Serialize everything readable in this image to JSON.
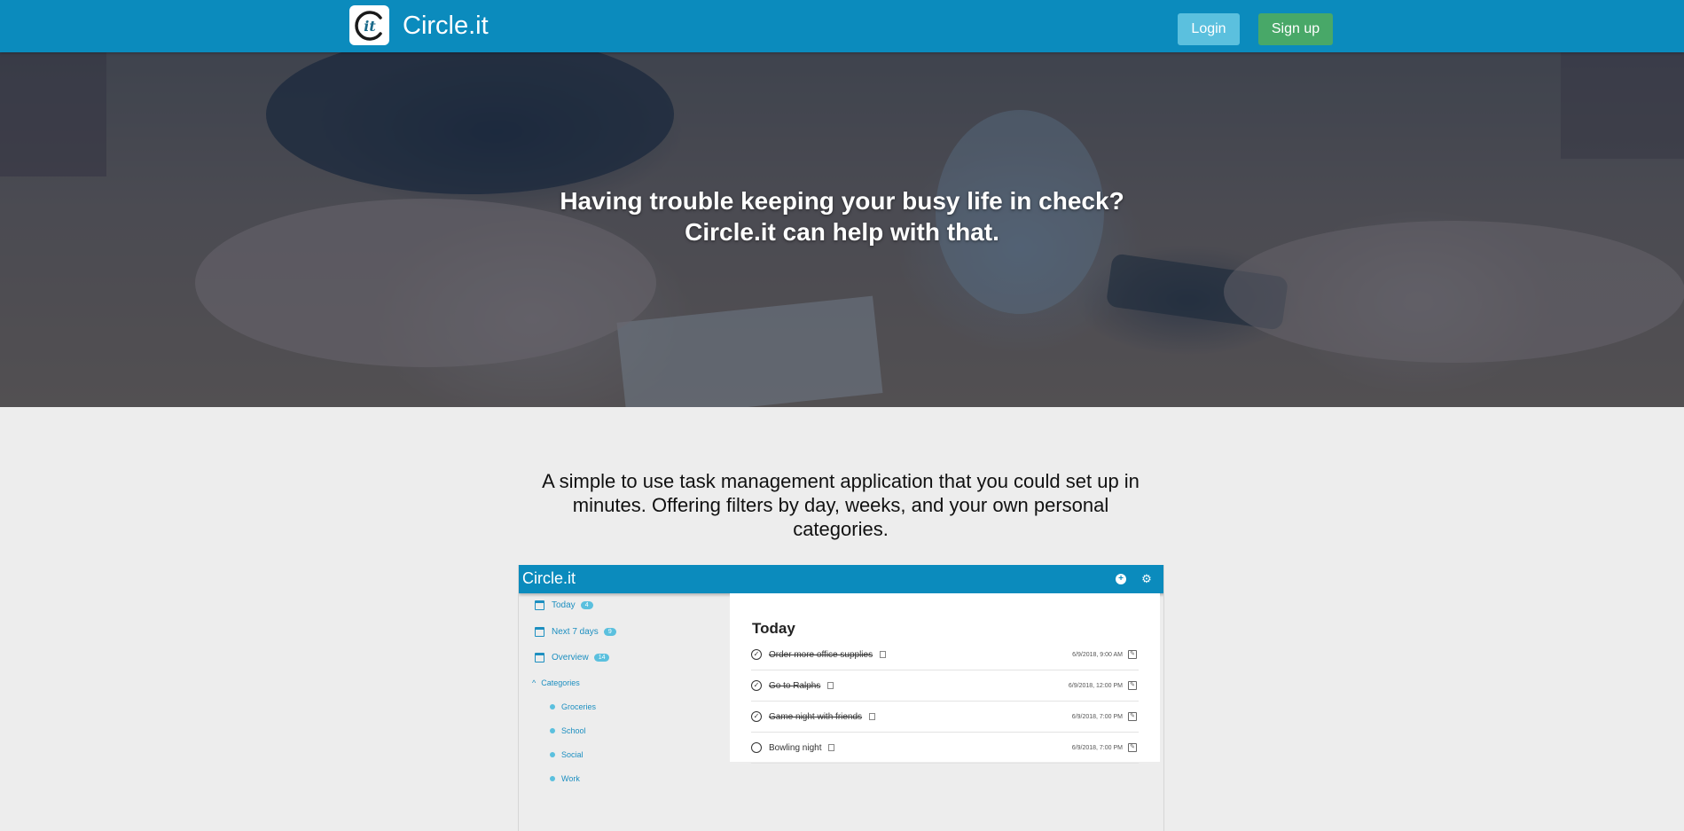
{
  "nav": {
    "brand": "Circle.it",
    "logo_text": "it",
    "login_label": "Login",
    "signup_label": "Sign up"
  },
  "hero": {
    "line1": "Having trouble keeping your busy life in check?",
    "line2": "Circle.it can help with that."
  },
  "description": "A simple to use task management application that you could set up in minutes. Offering filters by day, weeks, and your own personal categories.",
  "preview": {
    "title": "Circle.it",
    "add_icon": "plus-circle-icon",
    "settings_icon": "gear-icon",
    "sidebar": {
      "today_label": "Today",
      "today_count": "4",
      "next7_label": "Next 7 days",
      "next7_count": "9",
      "overview_label": "Overview",
      "overview_count": "14",
      "categories_label": "Categories",
      "categories": [
        "Groceries",
        "School",
        "Social",
        "Work"
      ]
    },
    "panel_title": "Today",
    "tasks": [
      {
        "name": "Order more office supplies",
        "time": "6/9/2018, 9:00 AM",
        "done": true
      },
      {
        "name": "Go to Ralphs",
        "time": "6/9/2018, 12:00 PM",
        "done": true
      },
      {
        "name": "Game night with friends",
        "time": "6/9/2018, 7:00 PM",
        "done": true
      },
      {
        "name": "Bowling night",
        "time": "6/9/2018, 7:00 PM",
        "done": false
      }
    ]
  },
  "colors": {
    "primary": "#0b8bbd",
    "login": "#5bc0de",
    "signup": "#48a868",
    "background": "#ededed"
  }
}
